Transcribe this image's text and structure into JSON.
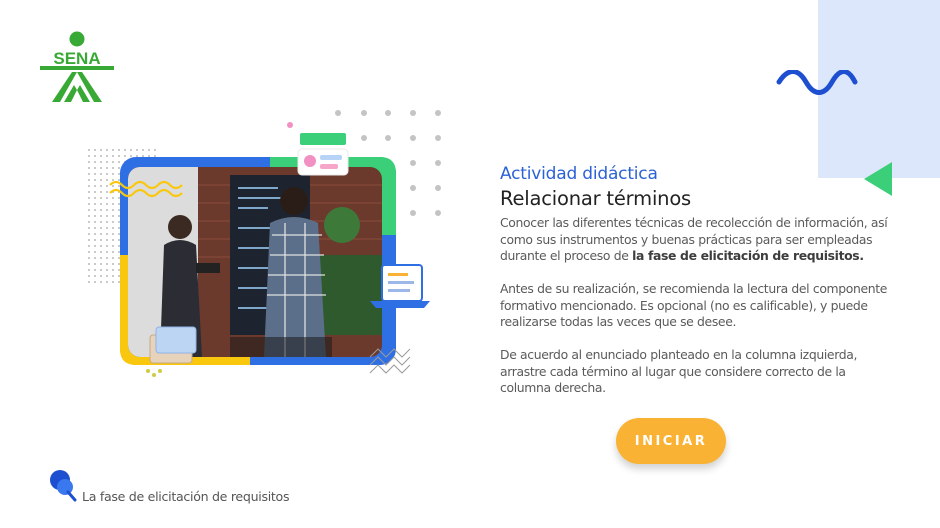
{
  "brand": {
    "logo_text": "SENA",
    "logo_color": "#39a935"
  },
  "activity": {
    "kicker": "Actividad didáctica",
    "title": "Relacionar términos",
    "intro_prefix": "Conocer las diferentes técnicas de recolección de información, así como sus instrumentos y buenas prácticas para ser empleadas durante el proceso de ",
    "intro_bold": "la fase de elicitación de requisitos.",
    "paragraph_2": "Antes de su realización, se recomienda la lectura del componente formativo mencionado.  Es opcional (no es calificable), y puede realizarse todas las veces que se desee.",
    "paragraph_3": "De acuerdo al enunciado planteado en la columna izquierda, arrastre cada término al lugar que considere correcto de la columna derecha."
  },
  "start_button": {
    "label": "INICIAR",
    "color": "#f9b233"
  },
  "footer": {
    "icon": "pushpin-icon",
    "text": "La fase de elicitación de requisitos"
  },
  "colors": {
    "accent_blue": "#2b62d6",
    "accent_green": "#3ccf7a",
    "accent_yellow": "#f9c80e",
    "panel": "#dde7fb"
  }
}
